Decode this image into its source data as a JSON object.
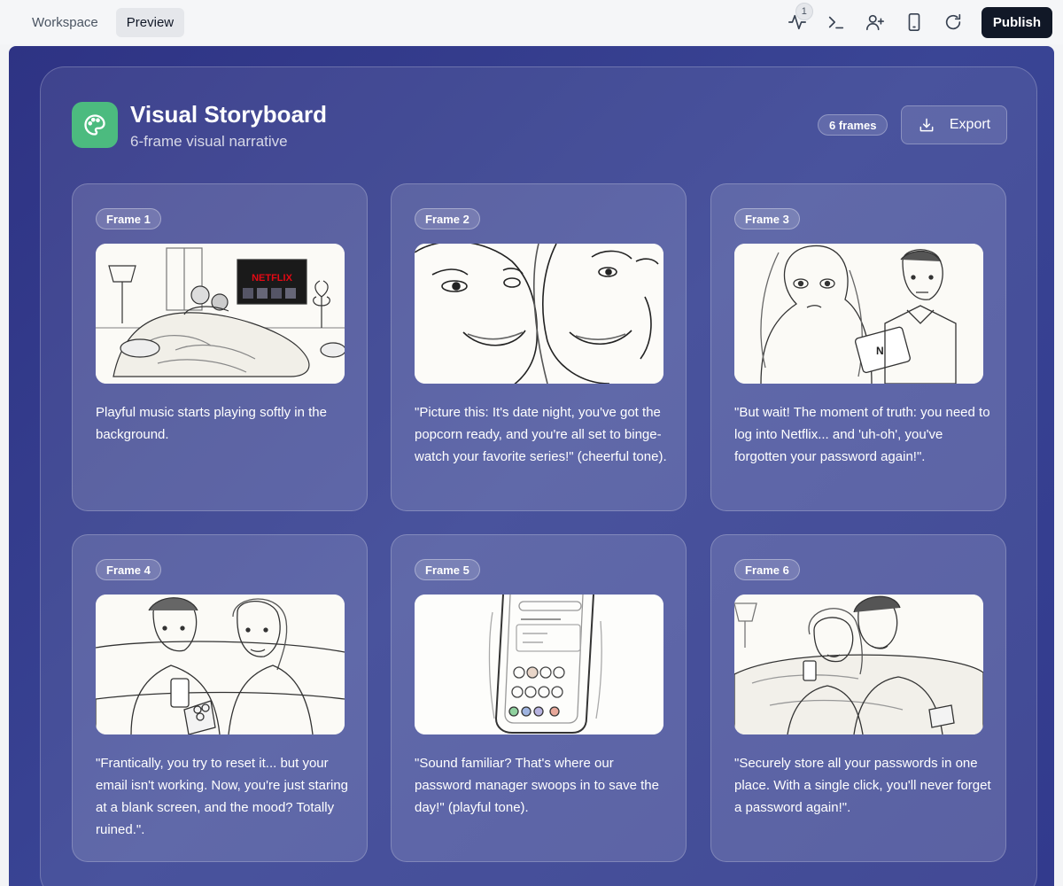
{
  "topbar": {
    "tabs": [
      {
        "label": "Workspace",
        "active": false
      },
      {
        "label": "Preview",
        "active": true
      }
    ],
    "activity_badge": "1",
    "publish_label": "Publish"
  },
  "storyboard": {
    "title": "Visual Storyboard",
    "subtitle": "6-frame visual narrative",
    "frame_count_label": "6 frames",
    "export_label": "Export",
    "accent_color": "#4cbb7f",
    "frames": [
      {
        "label": "Frame 1",
        "caption": "Playful music starts playing softly in the background.",
        "tv_logo": "NETFLIX"
      },
      {
        "label": "Frame 2",
        "caption": "\"Picture this: It's date night, you've got the popcorn ready, and you're all set to binge-watch your favorite series!\" (cheerful tone)."
      },
      {
        "label": "Frame 3",
        "caption": "\"But wait! The moment of truth: you need to log into Netflix... and 'uh-oh', you've forgotten your password again!\"."
      },
      {
        "label": "Frame 4",
        "caption": "\"Frantically, you try to reset it... but your email isn't working. Now, you're just staring at a blank screen, and the mood? Totally ruined.\"."
      },
      {
        "label": "Frame 5",
        "caption": "\"Sound familiar? That's where our password manager swoops in to save the day!\" (playful tone)."
      },
      {
        "label": "Frame 6",
        "caption": "\"Securely store all your passwords in one place. With a single click, you'll never forget a password again!\"."
      }
    ]
  }
}
